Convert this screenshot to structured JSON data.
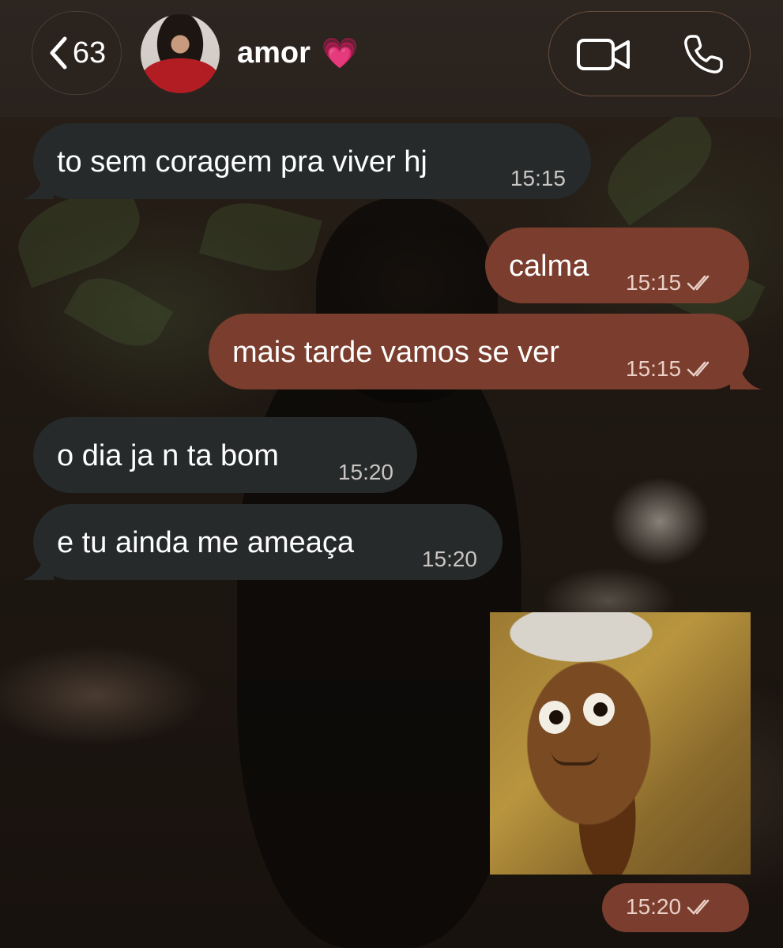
{
  "header": {
    "back_count": "63",
    "contact_name": "amor",
    "contact_emoji": "💗",
    "video_icon": "video-camera-icon",
    "call_icon": "phone-icon"
  },
  "messages": [
    {
      "direction": "incoming",
      "text": "to sem coragem pra viver hj",
      "time": "15:15"
    },
    {
      "direction": "outgoing",
      "text": "calma",
      "time": "15:15",
      "status": "read"
    },
    {
      "direction": "outgoing",
      "text": "mais tarde vamos se ver",
      "time": "15:15",
      "status": "read"
    },
    {
      "direction": "incoming",
      "text": "o dia ja n ta bom",
      "time": "15:20"
    },
    {
      "direction": "incoming",
      "text": "e tu ainda me ameaça",
      "time": "15:20"
    },
    {
      "direction": "outgoing",
      "type": "sticker",
      "time": "15:20",
      "status": "read"
    }
  ],
  "colors": {
    "incoming_bubble": "#262a2b",
    "outgoing_bubble": "#7b3d2d",
    "header_bg": "#2d2520"
  }
}
